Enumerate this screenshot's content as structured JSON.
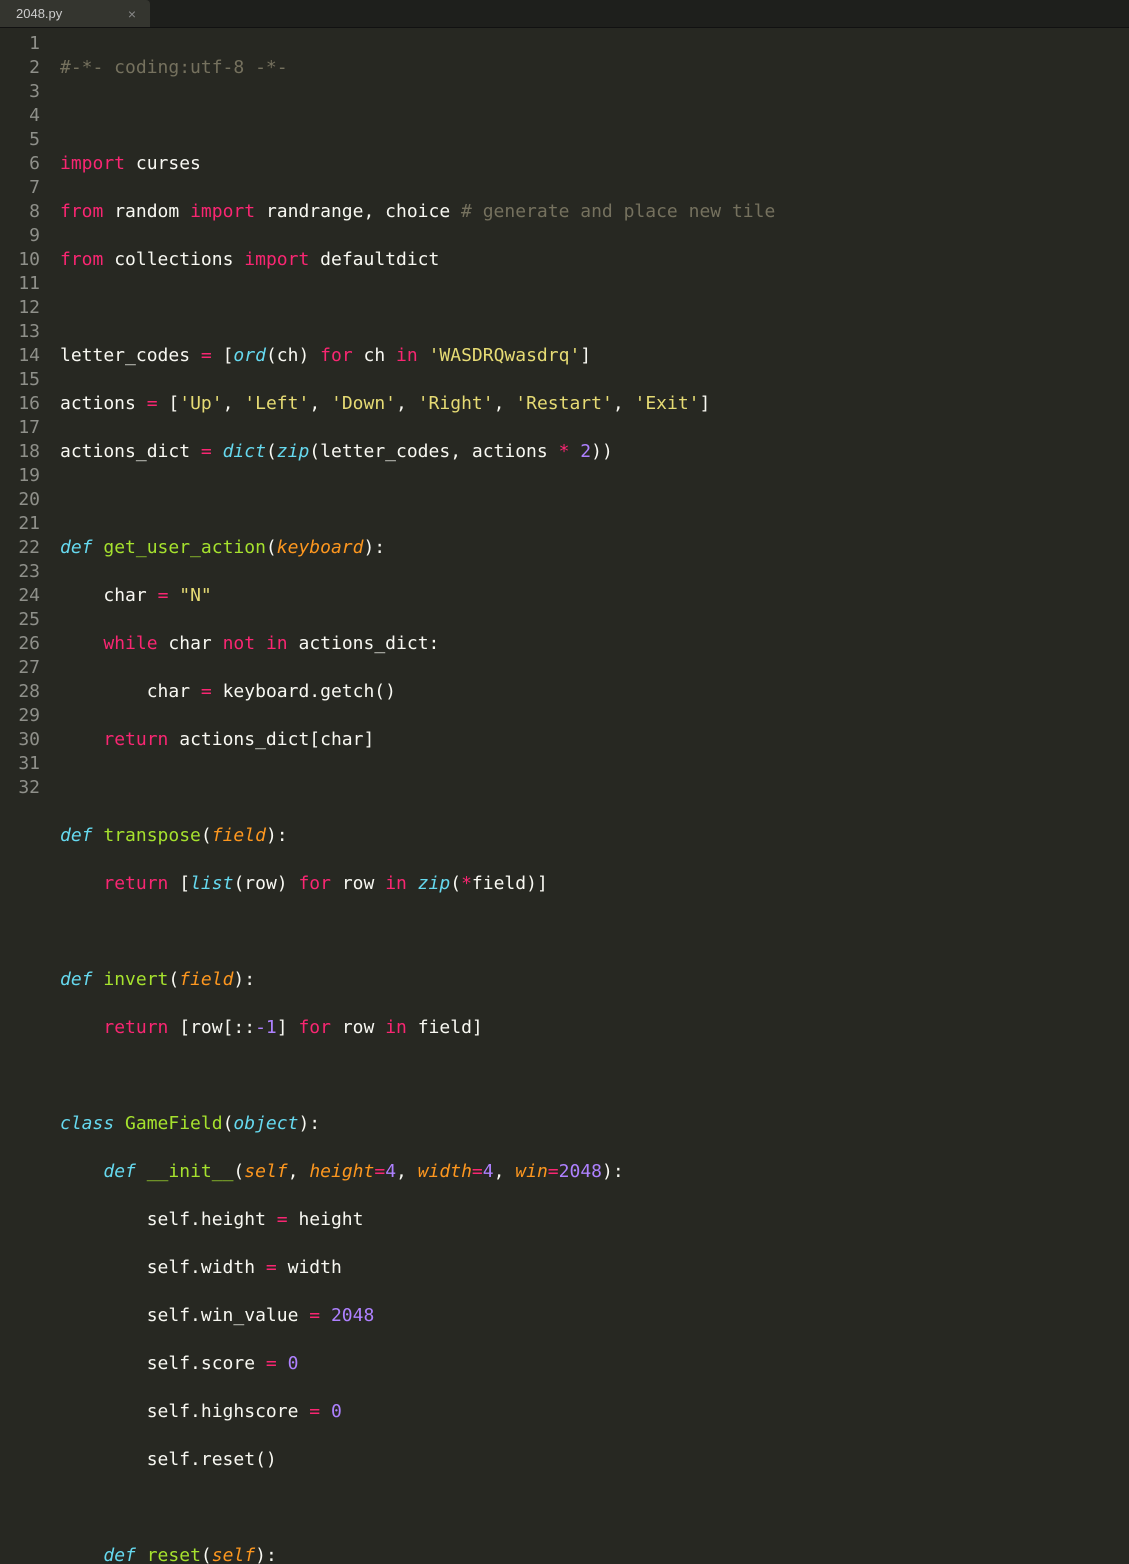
{
  "tab": {
    "filename": "2048.py",
    "close_glyph": "×"
  },
  "line_count": 32,
  "code": {
    "l1": {
      "cmt": "#-*- coding:utf-8 -*-"
    },
    "l3": {
      "kw_import": "import",
      "mod": "curses"
    },
    "l4": {
      "kw_from": "from",
      "mod": "random",
      "kw_import": "import",
      "names": "randrange, choice",
      "cmt": "# generate and place new tile"
    },
    "l5": {
      "kw_from": "from",
      "mod": "collections",
      "kw_import": "import",
      "names": "defaultdict"
    },
    "l7": {
      "var": "letter_codes",
      "eq": "=",
      "lb": "[",
      "ord": "ord",
      "arg": "(ch)",
      "for": "for",
      "ch": "ch",
      "in": "in",
      "str": "'WASDRQwasdrq'",
      "rb": "]"
    },
    "l8": {
      "var": "actions",
      "eq": "=",
      "lb": "[",
      "s1": "'Up'",
      "s2": "'Left'",
      "s3": "'Down'",
      "s4": "'Right'",
      "s5": "'Restart'",
      "s6": "'Exit'",
      "rb": "]"
    },
    "l9": {
      "var": "actions_dict",
      "eq": "=",
      "dict": "dict",
      "zip": "zip",
      "a1": "letter_codes",
      "a2": "actions",
      "star": "*",
      "two": "2"
    },
    "l11": {
      "def": "def",
      "fn": "get_user_action",
      "p1": "keyboard"
    },
    "l12": {
      "var": "char",
      "eq": "=",
      "str": "\"N\""
    },
    "l13": {
      "while": "while",
      "a": "char",
      "not": "not",
      "in": "in",
      "b": "actions_dict:"
    },
    "l14": {
      "lhs": "char",
      "eq": "=",
      "rhs": "keyboard.getch()"
    },
    "l15": {
      "ret": "return",
      "expr": "actions_dict[char]"
    },
    "l17": {
      "def": "def",
      "fn": "transpose",
      "p1": "field"
    },
    "l18": {
      "ret": "return",
      "lb": "[",
      "list": "list",
      "arg": "(row)",
      "for": "for",
      "row": "row",
      "in": "in",
      "zip": "zip",
      "star": "*",
      "f": "field",
      "rb": "]"
    },
    "l20": {
      "def": "def",
      "fn": "invert",
      "p1": "field"
    },
    "l21": {
      "ret": "return",
      "lb": "[row[::",
      "neg1": "-1",
      "rb1": "]",
      "for": "for",
      "row": "row",
      "in": "in",
      "f": "field]"
    },
    "l23": {
      "class": "class",
      "name": "GameField",
      "obj": "object"
    },
    "l24": {
      "def": "def",
      "fn": "__init__",
      "self": "self",
      "p2": "height",
      "v2": "4",
      "p3": "width",
      "v3": "4",
      "p4": "win",
      "v4": "2048",
      "eq": "="
    },
    "l25": {
      "lhs": "self.height",
      "eq": "=",
      "rhs": "height"
    },
    "l26": {
      "lhs": "self.width",
      "eq": "=",
      "rhs": "width"
    },
    "l27": {
      "lhs": "self.win_value",
      "eq": "=",
      "rhs": "2048"
    },
    "l28": {
      "lhs": "self.score",
      "eq": "=",
      "rhs": "0"
    },
    "l29": {
      "lhs": "self.highscore",
      "eq": "=",
      "rhs": "0"
    },
    "l30": {
      "expr": "self.reset()"
    },
    "l32": {
      "def": "def",
      "fn": "reset",
      "self": "self"
    }
  },
  "colors": {
    "background": "#272822",
    "keyword": "#f92672",
    "function": "#a6e22e",
    "builtin": "#66d9ef",
    "param": "#fd971f",
    "string": "#e6db74",
    "number": "#ae81ff",
    "comment": "#75715e",
    "text": "#f8f8f2"
  }
}
